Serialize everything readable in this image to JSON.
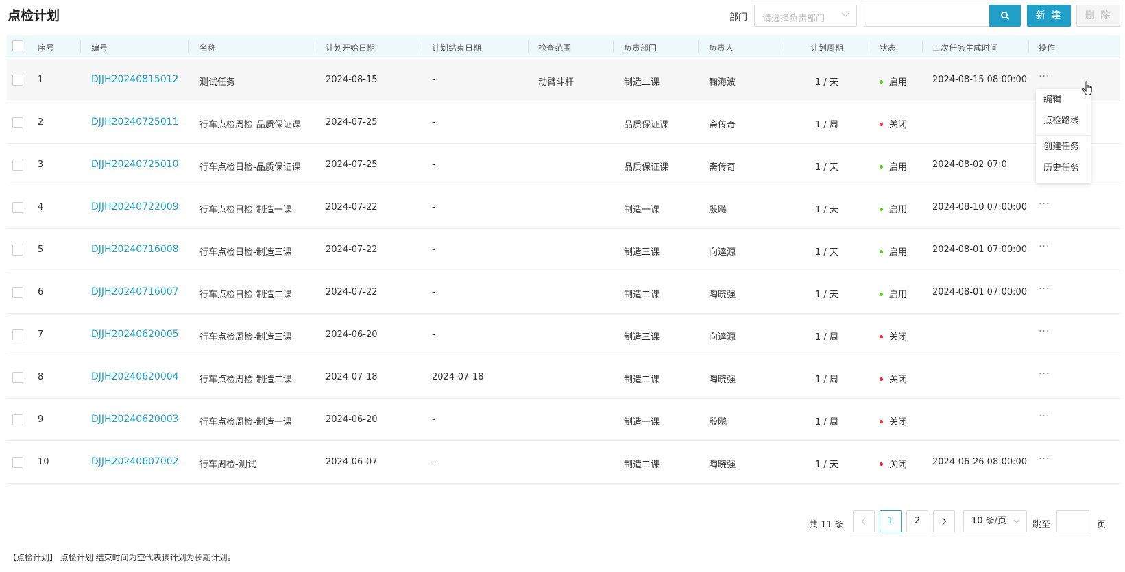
{
  "header": {
    "title": "点检计划",
    "dept_label": "部门",
    "dept_placeholder": "请选择负责部门",
    "search_value": "",
    "new_label": "新 建",
    "delete_label": "删 除"
  },
  "table": {
    "columns": [
      "序号",
      "编号",
      "名称",
      "计划开始日期",
      "计划结束日期",
      "检查范围",
      "负责部门",
      "负责人",
      "计划周期",
      "状态",
      "上次任务生成时间",
      "操作"
    ],
    "rows": [
      {
        "idx": "1",
        "code": "DJJH20240815012",
        "name": "测试任务",
        "start": "2024-08-15",
        "end": "-",
        "scope": "动臂斗杆",
        "dept": "制造二课",
        "owner": "鞠海波",
        "cycle": "1 / 天",
        "status": "启用",
        "last": "2024-08-15 08:00:00"
      },
      {
        "idx": "2",
        "code": "DJJH20240725011",
        "name": "行车点检周检-品质保证课",
        "start": "2024-07-25",
        "end": "-",
        "scope": "",
        "dept": "品质保证课",
        "owner": "斋传奇",
        "cycle": "1 / 周",
        "status": "关闭",
        "last": ""
      },
      {
        "idx": "3",
        "code": "DJJH20240725010",
        "name": "行车点检日检-品质保证课",
        "start": "2024-07-25",
        "end": "-",
        "scope": "",
        "dept": "品质保证课",
        "owner": "斋传奇",
        "cycle": "1 / 天",
        "status": "启用",
        "last": "2024-08-02 07:0"
      },
      {
        "idx": "4",
        "code": "DJJH20240722009",
        "name": "行车点检日检-制造一课",
        "start": "2024-07-22",
        "end": "-",
        "scope": "",
        "dept": "制造一课",
        "owner": "殷飚",
        "cycle": "1 / 天",
        "status": "启用",
        "last": "2024-08-10 07:00:00"
      },
      {
        "idx": "5",
        "code": "DJJH20240716008",
        "name": "行车点检日检-制造三课",
        "start": "2024-07-22",
        "end": "-",
        "scope": "",
        "dept": "制造三课",
        "owner": "向逵源",
        "cycle": "1 / 天",
        "status": "启用",
        "last": "2024-08-01 07:00:00"
      },
      {
        "idx": "6",
        "code": "DJJH20240716007",
        "name": "行车点检日检-制造二课",
        "start": "2024-07-22",
        "end": "-",
        "scope": "",
        "dept": "制造二课",
        "owner": "陶晓强",
        "cycle": "1 / 天",
        "status": "启用",
        "last": "2024-08-01 07:00:00"
      },
      {
        "idx": "7",
        "code": "DJJH20240620005",
        "name": "行车点检周检-制造三课",
        "start": "2024-06-20",
        "end": "-",
        "scope": "",
        "dept": "制造三课",
        "owner": "向逵源",
        "cycle": "1 / 周",
        "status": "关闭",
        "last": ""
      },
      {
        "idx": "8",
        "code": "DJJH20240620004",
        "name": "行车点检周检-制造二课",
        "start": "2024-07-18",
        "end": "2024-07-18",
        "scope": "",
        "dept": "制造二课",
        "owner": "陶晓强",
        "cycle": "1 / 周",
        "status": "关闭",
        "last": ""
      },
      {
        "idx": "9",
        "code": "DJJH20240620003",
        "name": "行车点检周检-制造一课",
        "start": "2024-06-20",
        "end": "-",
        "scope": "",
        "dept": "制造一课",
        "owner": "殷飚",
        "cycle": "1 / 周",
        "status": "关闭",
        "last": ""
      },
      {
        "idx": "10",
        "code": "DJJH20240607002",
        "name": "行车周检-测试",
        "start": "2024-06-07",
        "end": "-",
        "scope": "",
        "dept": "制造二课",
        "owner": "陶晓强",
        "cycle": "1 / 天",
        "status": "关闭",
        "last": "2024-06-26 08:00:00"
      }
    ],
    "more_label": "···"
  },
  "dropdown": {
    "items": [
      "编辑",
      "点检路线",
      "创建任务",
      "历史任务"
    ]
  },
  "pagination": {
    "total_text": "共 11 条",
    "prev": "<",
    "pages": [
      "1",
      "2"
    ],
    "next": ">",
    "page_size": "10 条/页",
    "jump_label": "跳至",
    "page_label": "页"
  },
  "footnote": "【点检计划】 点检计划 结束时间为空代表该计划为长期计划。",
  "colors": {
    "accent": "#20a0c8",
    "enabled_dot": "#52c41a",
    "disabled_dot": "#f5222d",
    "header_bg": "#eef9fc"
  },
  "icons": {
    "search": "search-icon",
    "chevron": "chevron-down-icon",
    "cursor": "hand-pointer-icon"
  }
}
